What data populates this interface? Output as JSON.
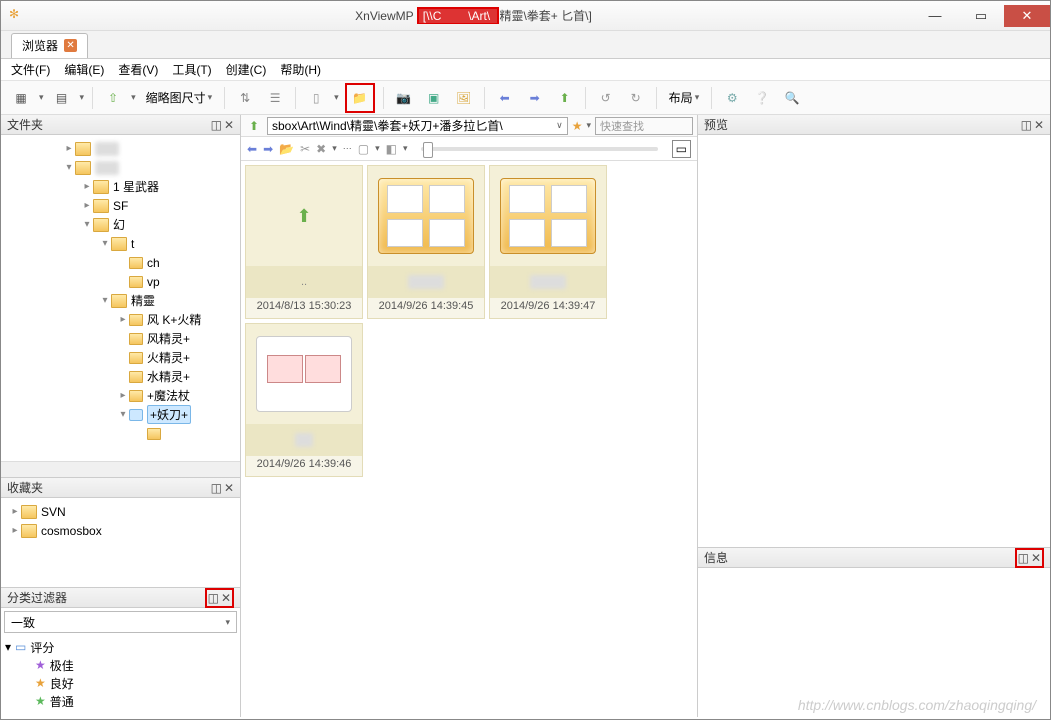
{
  "titlebar": {
    "app_name": "XnViewMP",
    "path_prefix": "[\\\\C",
    "path_mid": "\\Art\\",
    "path_suffix": "精靈\\拳套+        匕首\\]"
  },
  "tab": {
    "label": "浏览器"
  },
  "menu": {
    "file": "文件(F)",
    "edit": "编辑(E)",
    "view": "查看(V)",
    "tools": "工具(T)",
    "create": "创建(C)",
    "help": "帮助(H)"
  },
  "toolbar": {
    "thumb_size_label": "缩略图尺寸",
    "layout_label": "布局"
  },
  "panels": {
    "folders": "文件夹",
    "favorites": "收藏夹",
    "filter": "分类过滤器",
    "preview": "预览",
    "info": "信息"
  },
  "folder_tree": {
    "n1": "1    星武器",
    "n2": "SF",
    "n3": "幻",
    "n4": "t",
    "n5": "ch",
    "n6": "vp",
    "n7": "精靈",
    "n8": "风    K+火精",
    "n9": "风精灵+",
    "n10": "火精灵+",
    "n11": "水精灵+",
    "n12": "+魔法杖",
    "n13": "+妖刀+",
    "n14": ""
  },
  "favorites": {
    "f1": "SVN",
    "f2": "cosmosbox"
  },
  "filter": {
    "match": "一致",
    "rating": "评分",
    "r1": "极佳",
    "r2": "良好",
    "r3": "普通"
  },
  "pathbar": {
    "path": "sbox\\Art\\Wind\\精靈\\拳套+妖刀+潘多拉匕首\\",
    "search_placeholder": "快速查找"
  },
  "thumbs": {
    "up": "..",
    "t1_date": "2014/8/13 15:30:23",
    "t2_date": "2014/9/26 14:39:45",
    "t3_date": "2014/9/26 14:39:47",
    "t4_date": "2014/9/26 14:39:46"
  },
  "watermark": "http://www.cnblogs.com/zhaoqingqing/"
}
